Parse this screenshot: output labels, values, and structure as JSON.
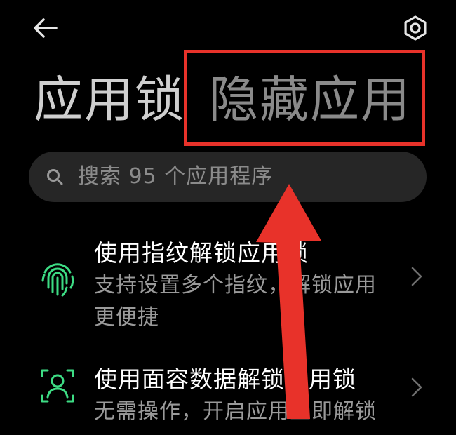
{
  "header": {
    "back_icon": "back-arrow-icon",
    "settings_icon": "gear-icon"
  },
  "tabs": [
    {
      "label": "应用锁",
      "active": true
    },
    {
      "label": "隐藏应用",
      "active": false
    }
  ],
  "search": {
    "placeholder": "搜索 95 个应用程序",
    "icon": "search-icon"
  },
  "options": [
    {
      "icon": "fingerprint-icon",
      "title": "使用指纹解锁应用锁",
      "description": "支持设置多个指纹，解锁应用更便捷"
    },
    {
      "icon": "face-scan-icon",
      "title": "使用面容数据解锁应用锁",
      "description": "无需操作，开启应用立即解锁"
    }
  ],
  "colors": {
    "background": "#000000",
    "accent_green": "#3ddc84",
    "annotation_red": "#e8322a"
  }
}
